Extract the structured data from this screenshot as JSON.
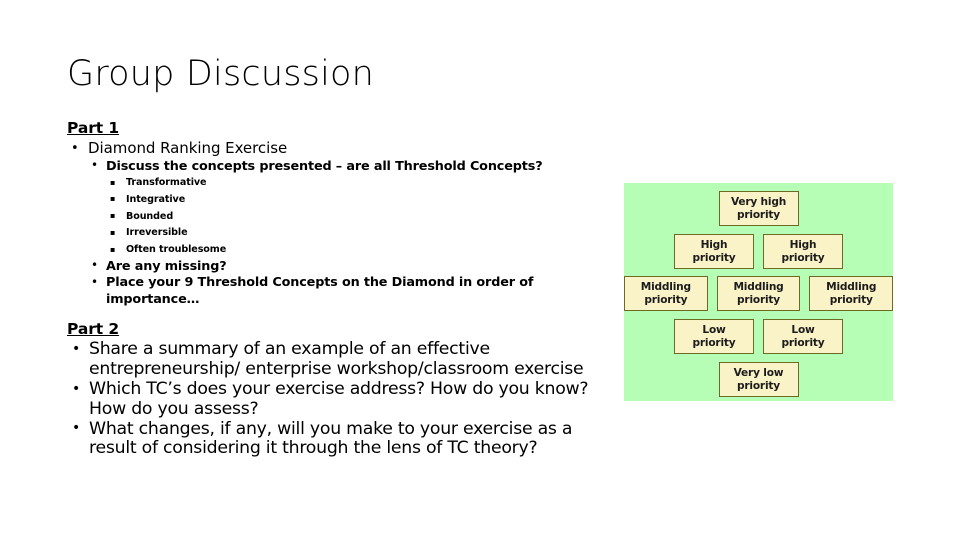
{
  "slide": {
    "title": "Group Discussion",
    "background_color": "#ffffff"
  },
  "part1": {
    "heading": "Part 1",
    "bullets": [
      {
        "text": "Diamond Ranking Exercise"
      }
    ],
    "sub_bullets": [
      {
        "text": "Discuss the concepts presented – are all Threshold Concepts?"
      },
      {
        "text": "Are any missing?"
      },
      {
        "text": "Place your 9 Threshold Concepts on the Diamond in order of importance…"
      }
    ],
    "concepts": [
      "Transformative",
      "Integrative",
      "Bounded",
      "Irreversible",
      "Often troublesome"
    ]
  },
  "part2": {
    "heading": "Part 2",
    "bullets": [
      "Share a summary of an example of an effective entrepreneurship/ enterprise workshop/classroom exercise",
      "Which TC’s does your exercise address? How do you know? How do you assess?",
      "What changes, if any, will you make to your exercise as a result of considering it through the lens of TC theory?"
    ]
  },
  "diamond": {
    "background_color": "#b6feb6",
    "box_fill_color": "#fbf3c8",
    "box_border_color": "#6b6b25",
    "rows": [
      {
        "boxes": [
          {
            "line1": "Very high",
            "line2": "priority"
          }
        ]
      },
      {
        "boxes": [
          {
            "line1": "High",
            "line2": "priority"
          },
          {
            "line1": "High",
            "line2": "priority"
          }
        ]
      },
      {
        "boxes": [
          {
            "line1": "Middling",
            "line2": "priority"
          },
          {
            "line1": "Middling",
            "line2": "priority"
          },
          {
            "line1": "Middling",
            "line2": "priority"
          }
        ]
      },
      {
        "boxes": [
          {
            "line1": "Low",
            "line2": "priority"
          },
          {
            "line1": "Low",
            "line2": "priority"
          }
        ]
      },
      {
        "boxes": [
          {
            "line1": "Very low",
            "line2": "priority"
          }
        ]
      }
    ]
  }
}
